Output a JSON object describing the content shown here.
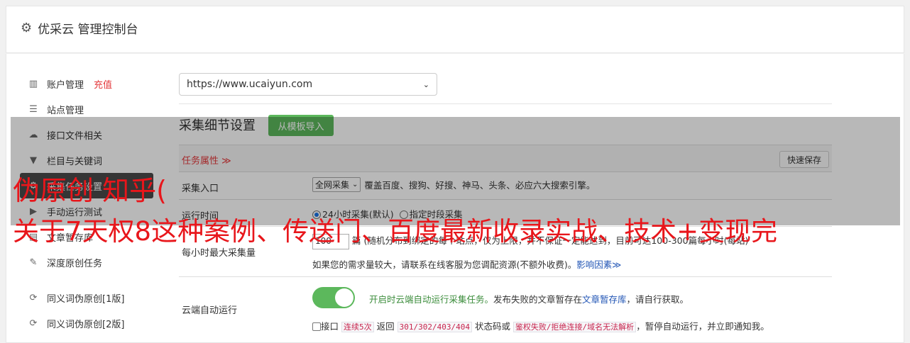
{
  "header": {
    "title": "优采云 管理控制台"
  },
  "sidebar": {
    "items": [
      {
        "label": "账户管理",
        "extra": "充值",
        "icon": "bar-chart-icon"
      },
      {
        "label": "站点管理",
        "icon": "server-icon"
      },
      {
        "label": "接口文件相关",
        "icon": "cloud-upload-icon"
      },
      {
        "label": "栏目与关键词",
        "icon": "filter-icon"
      },
      {
        "label": "采集任务设置",
        "icon": "gear-icon",
        "active": true
      },
      {
        "label": "手动运行测试",
        "icon": "play-icon"
      },
      {
        "label": "文章暂存库",
        "icon": "archive-icon"
      },
      {
        "label": "深度原创任务",
        "icon": "edit-icon"
      },
      {
        "label": "同义词伪原创[1版]",
        "icon": "refresh-icon"
      },
      {
        "label": "同义词伪原创[2版]",
        "icon": "refresh-icon"
      }
    ]
  },
  "site_select": {
    "value": "https://www.ucaiyun.com"
  },
  "detail": {
    "title": "采集细节设置",
    "template_button": "从模板导入",
    "task_attr": "任务属性 ≫",
    "quick_save": "快速保存",
    "entry": {
      "label": "采集入口",
      "select": "全网采集",
      "desc": "覆盖百度、搜狗、好搜、神马、头条、必应六大搜索引擎。"
    },
    "runtime": {
      "label": "运行时间",
      "opt1": "24小时采集(默认)",
      "opt2": "指定时段采集"
    },
    "maxrate": {
      "label": "每小时最大采集量",
      "value": "100",
      "desc": "篇 (随机分布到绑定的每个站点，仅为上限，并不保证一定能达到，目前可达100-300篇每小时(每站)",
      "note": "如果您的需求量较大，请联系在线客服为您调配资源(不额外收费)。",
      "link": "影响因素≫"
    },
    "cloud": {
      "label": "云端自动运行",
      "on_text": "开启时云端自动运行采集任务。",
      "text2": "发布失败的文章暂存在",
      "link": "文章暂存库",
      "text3": "，请自行获取。",
      "cb_pre": "接口",
      "code1": "连续5次",
      "mid1": "返回",
      "code2": "301/302/403/404",
      "mid2": "状态码或",
      "code3": "鉴权失败/拒绝连接/域名无法解析",
      "tail": "，暂停自动运行，并立即通知我。"
    }
  },
  "watermark": {
    "line1": "伪原创 知乎(",
    "line2": "关于7天权8这种案例、传送门、百度最新收录实战、技术+变现完"
  }
}
